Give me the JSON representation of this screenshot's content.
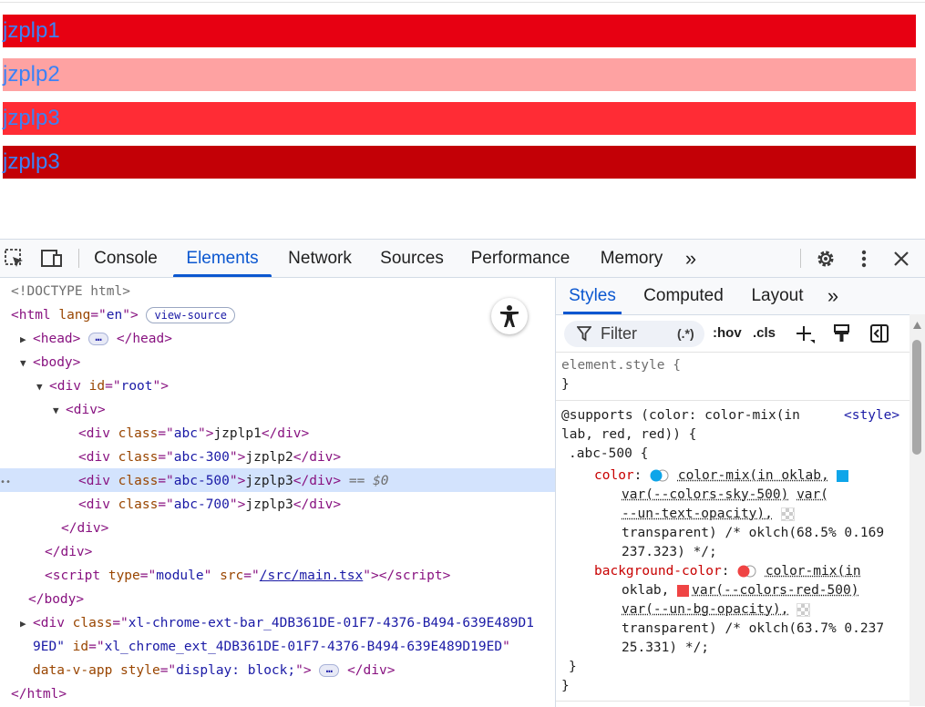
{
  "preview": {
    "rows": [
      {
        "text": "jzplp1",
        "bg": "#e70012"
      },
      {
        "text": "jzplp2",
        "bg": "#fea2a2"
      },
      {
        "text": "jzplp3",
        "bg": "#ff2c35"
      },
      {
        "text": "jzplp3",
        "bg": "#c30006"
      }
    ],
    "text_color": "#3b82f6"
  },
  "devtools": {
    "tabs": [
      "Console",
      "Elements",
      "Network",
      "Sources",
      "Performance",
      "Memory"
    ],
    "active_tab": "Elements",
    "more_tabs": "»",
    "accent": "#0b57d0"
  },
  "dom": {
    "doctype": "<!DOCTYPE html>",
    "html_lang": "en",
    "view_source": "view-source",
    "ellipsis": "…",
    "root_id": "root",
    "children": [
      {
        "class": "abc",
        "text": "jzplp1"
      },
      {
        "class": "abc-300",
        "text": "jzplp2"
      },
      {
        "class": "abc-500",
        "text": "jzplp3"
      },
      {
        "class": "abc-700",
        "text": "jzplp3"
      }
    ],
    "selected_marker": "== $0",
    "row_dots": "••",
    "script_type": "module",
    "script_src": "/src/main.tsx",
    "ext_class_1": "xl-chrome-ext-bar_4DB361DE-01F7-4376-B494-639E489D1",
    "ext_class_2": "9ED\"",
    "ext_id": "xl_chrome_ext_4DB361DE-01F7-4376-B494-639E489D19ED",
    "ext_attr": "data-v-app",
    "ext_style": "display: block;"
  },
  "styles": {
    "tabs": [
      "Styles",
      "Computed",
      "Layout"
    ],
    "active_tab": "Styles",
    "more": "»",
    "filter_placeholder": "Filter",
    "regex_toggle": "(.*)",
    "hov": ":hov",
    "cls": ".cls",
    "element_style": "element.style {",
    "close_brace": "}",
    "supports_line1": "@supports (color: color-mix(in",
    "supports_line2": "lab, red, red)) {",
    "source_link": "<style>",
    "selector": ".abc-500 {",
    "color_prop": "color",
    "color_val1": "color-mix(in oklab,",
    "color_var1": "var(--colors-sky-500)",
    "color_var2a": "var(",
    "color_var2b": "--un-text-opacity),",
    "color_tail": "transparent) /* oklch(68.5% 0.169",
    "color_tail2": "237.323) */;",
    "bg_prop": "background-color",
    "bg_val1": "color-mix(in",
    "bg_val2a": "oklab,",
    "bg_var1": "var(--colors-red-500)",
    "bg_var2": "var(--un-bg-opacity),",
    "bg_tail": "transparent) /* oklch(63.7% 0.237",
    "bg_tail2": "25.331) */;",
    "inner_close": "}",
    "outer_close": "}",
    "sky_color": "#0ea5e9",
    "red_color": "#ef4444"
  }
}
